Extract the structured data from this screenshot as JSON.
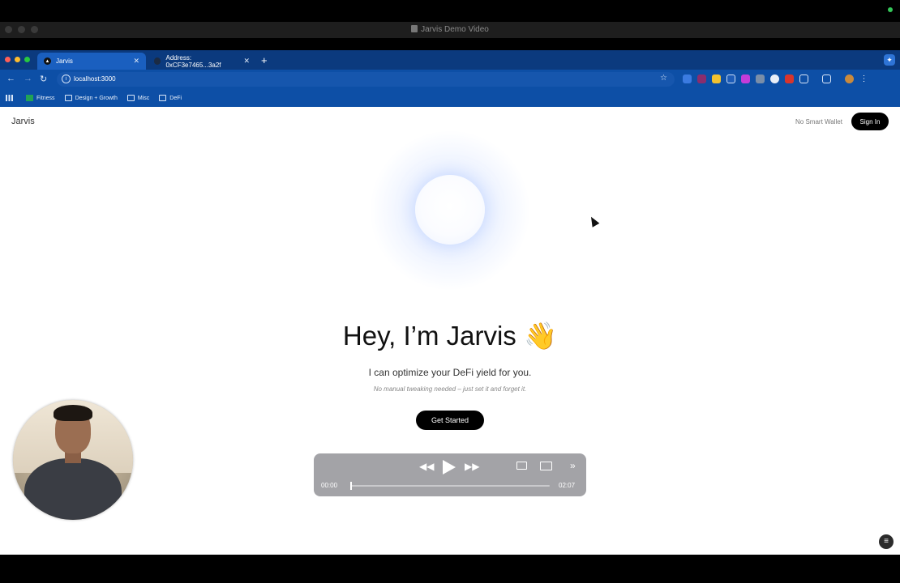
{
  "player_window": {
    "title": "Jarvis Demo Video"
  },
  "browser": {
    "tabs": [
      {
        "label": "Jarvis",
        "active": true
      },
      {
        "label": "Address: 0xCF3e7465...3a2f",
        "active": false
      }
    ],
    "url": "localhost:3000",
    "bookmarks": [
      "Fitness",
      "Design + Growth",
      "Misc",
      "DeFi"
    ]
  },
  "page": {
    "brand": "Jarvis",
    "wallet_status": "No Smart Wallet",
    "sign_in_label": "Sign In",
    "headline": "Hey, I’m Jarvis 👋",
    "subtitle": "I can optimize your DeFi yield for you.",
    "tagline": "No manual tweaking needed – just set it and forget it.",
    "cta_label": "Get Started"
  },
  "video": {
    "current_time": "00:00",
    "duration": "02:07",
    "progress": 0
  },
  "colors": {
    "chrome_blue": "#0d4fa6",
    "tabstrip_blue": "#0b3a7e",
    "black_button": "#000000"
  }
}
